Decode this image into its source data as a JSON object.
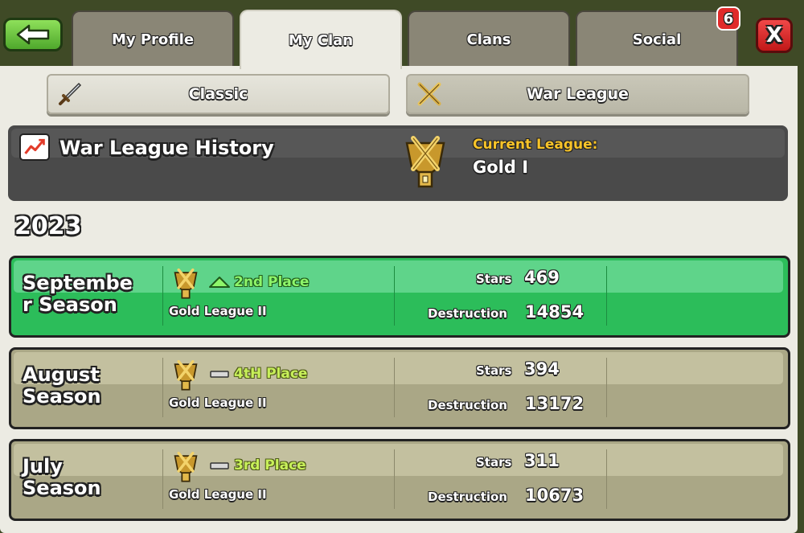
{
  "nav": {
    "back_label": "back",
    "close_label": "X",
    "tabs": [
      {
        "label": "My Profile",
        "active": false
      },
      {
        "label": "My Clan",
        "active": true
      },
      {
        "label": "Clans",
        "active": false
      },
      {
        "label": "Social",
        "active": false
      }
    ],
    "social_badge": "6"
  },
  "subtabs": [
    {
      "label": "Classic",
      "icon": "sword-icon",
      "selected": false
    },
    {
      "label": "War League",
      "icon": "crossed-swords-icon",
      "selected": true
    }
  ],
  "history": {
    "title": "War League History",
    "current_league_label": "Current League:",
    "current_league": "Gold I"
  },
  "year": "2023",
  "seasons": [
    {
      "name": "Septembe r Season",
      "name_line1": "Septembe",
      "name_line2": "r Season",
      "place": "2nd Place",
      "trend": "up",
      "league": "Gold League II",
      "stars_label": "Stars",
      "stars": "469",
      "destruction_label": "Destruction",
      "destruction": "14854",
      "color": "#2cbd5a"
    },
    {
      "name": "August Season",
      "name_line1": "August",
      "name_line2": "Season",
      "place": "4tH Place",
      "trend": "same",
      "league": "Gold League II",
      "stars_label": "Stars",
      "stars": "394",
      "destruction_label": "Destruction",
      "destruction": "13172",
      "color": "#aaa786"
    },
    {
      "name": "July Season",
      "name_line1": "July",
      "name_line2": "Season",
      "place": "3rd Place",
      "trend": "same",
      "league": "Gold League II",
      "stars_label": "Stars",
      "stars": "311",
      "destruction_label": "Destruction",
      "destruction": "10673",
      "color": "#aaa786"
    }
  ]
}
